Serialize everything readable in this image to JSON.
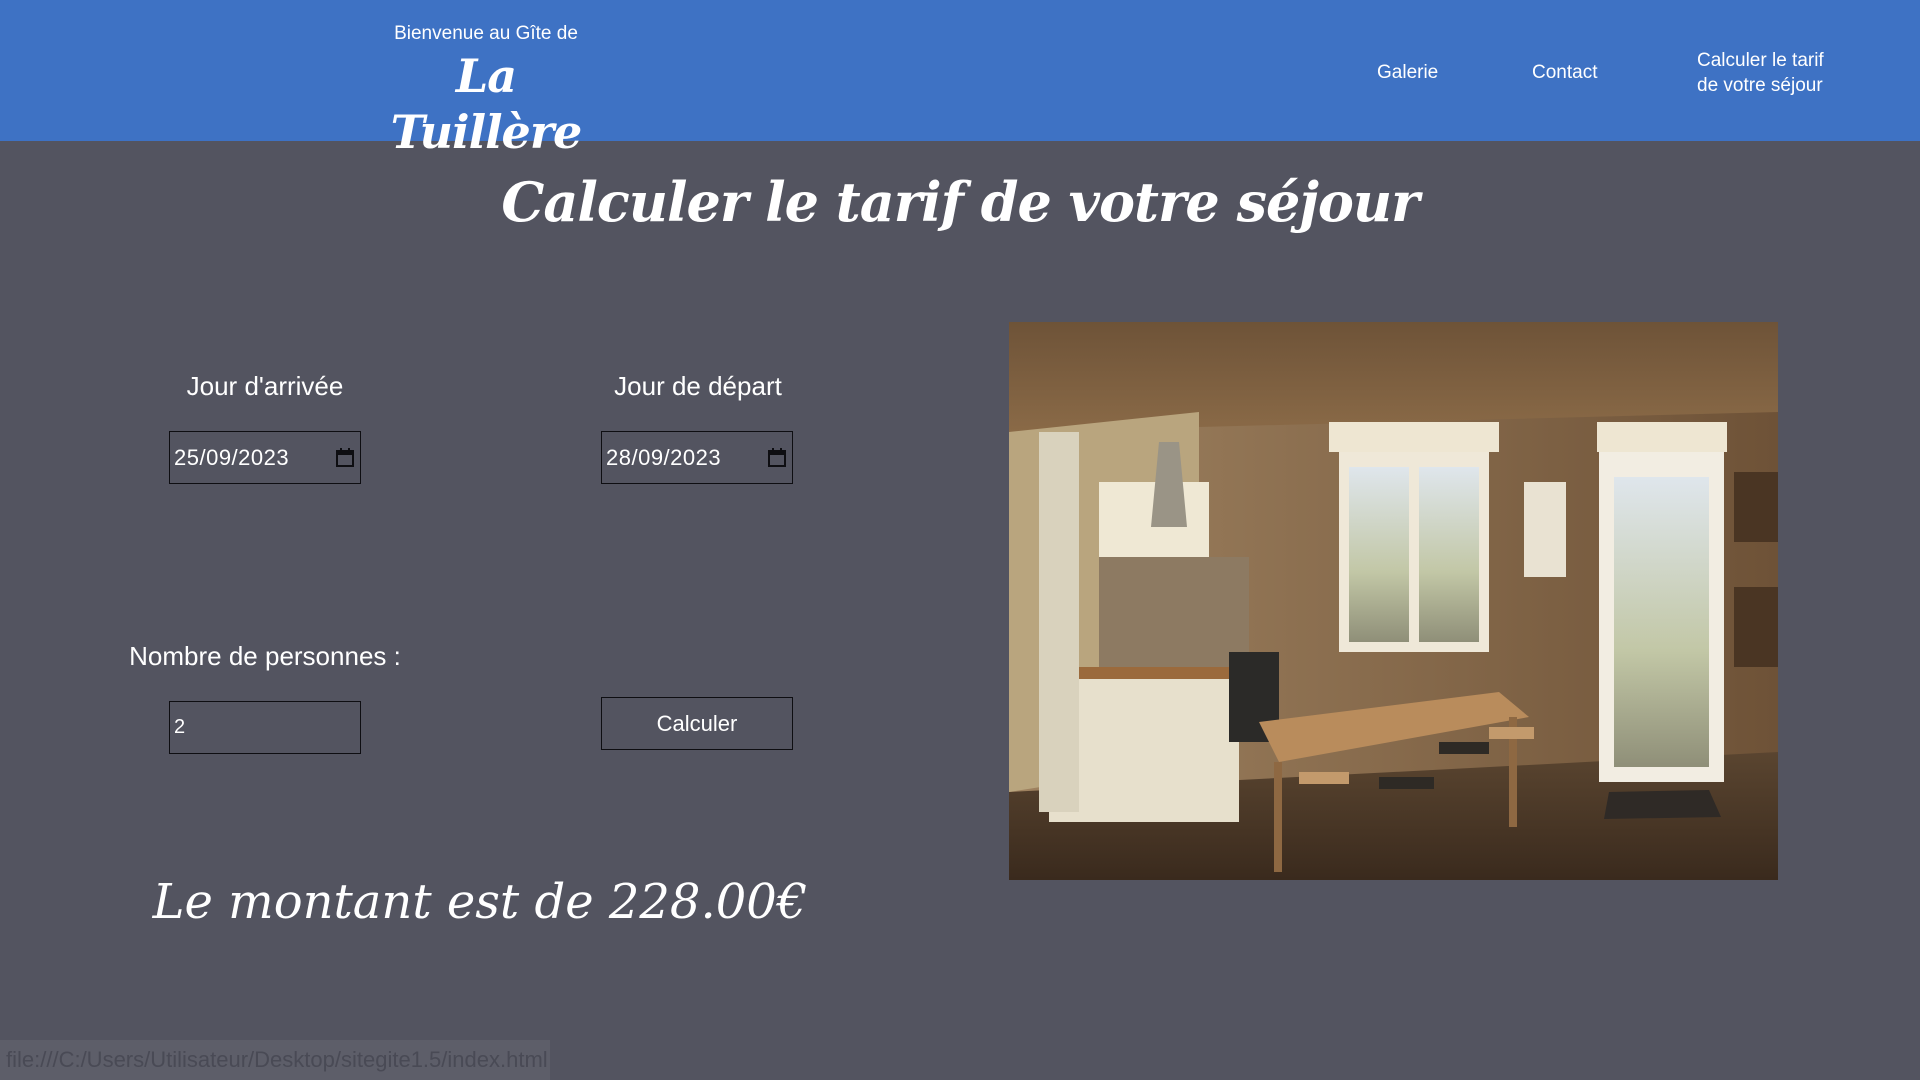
{
  "header": {
    "tagline": "Bienvenue au Gîte de",
    "brand_name": "La Tuillère",
    "nav": {
      "galerie": "Galerie",
      "contact": "Contact",
      "tarif": "Calculer le tarif de votre séjour"
    },
    "background_color": "#3e72c4"
  },
  "page": {
    "title": "Calculer le tarif de votre séjour",
    "background_color": "#535460"
  },
  "form": {
    "arrival": {
      "label": "Jour d'arrivée",
      "value": "25/09/2023",
      "icon": "calendar-icon"
    },
    "departure": {
      "label": "Jour de départ",
      "value": "28/09/2023",
      "icon": "calendar-icon"
    },
    "persons": {
      "label": "Nombre de personnes :",
      "value": "2"
    },
    "submit_label": "Calculer"
  },
  "result": {
    "text": "Le montant est de 228.00€"
  },
  "status_bar": {
    "url": "file:///C:/Users/Utilisateur/Desktop/sitegite1.5/index.html"
  }
}
